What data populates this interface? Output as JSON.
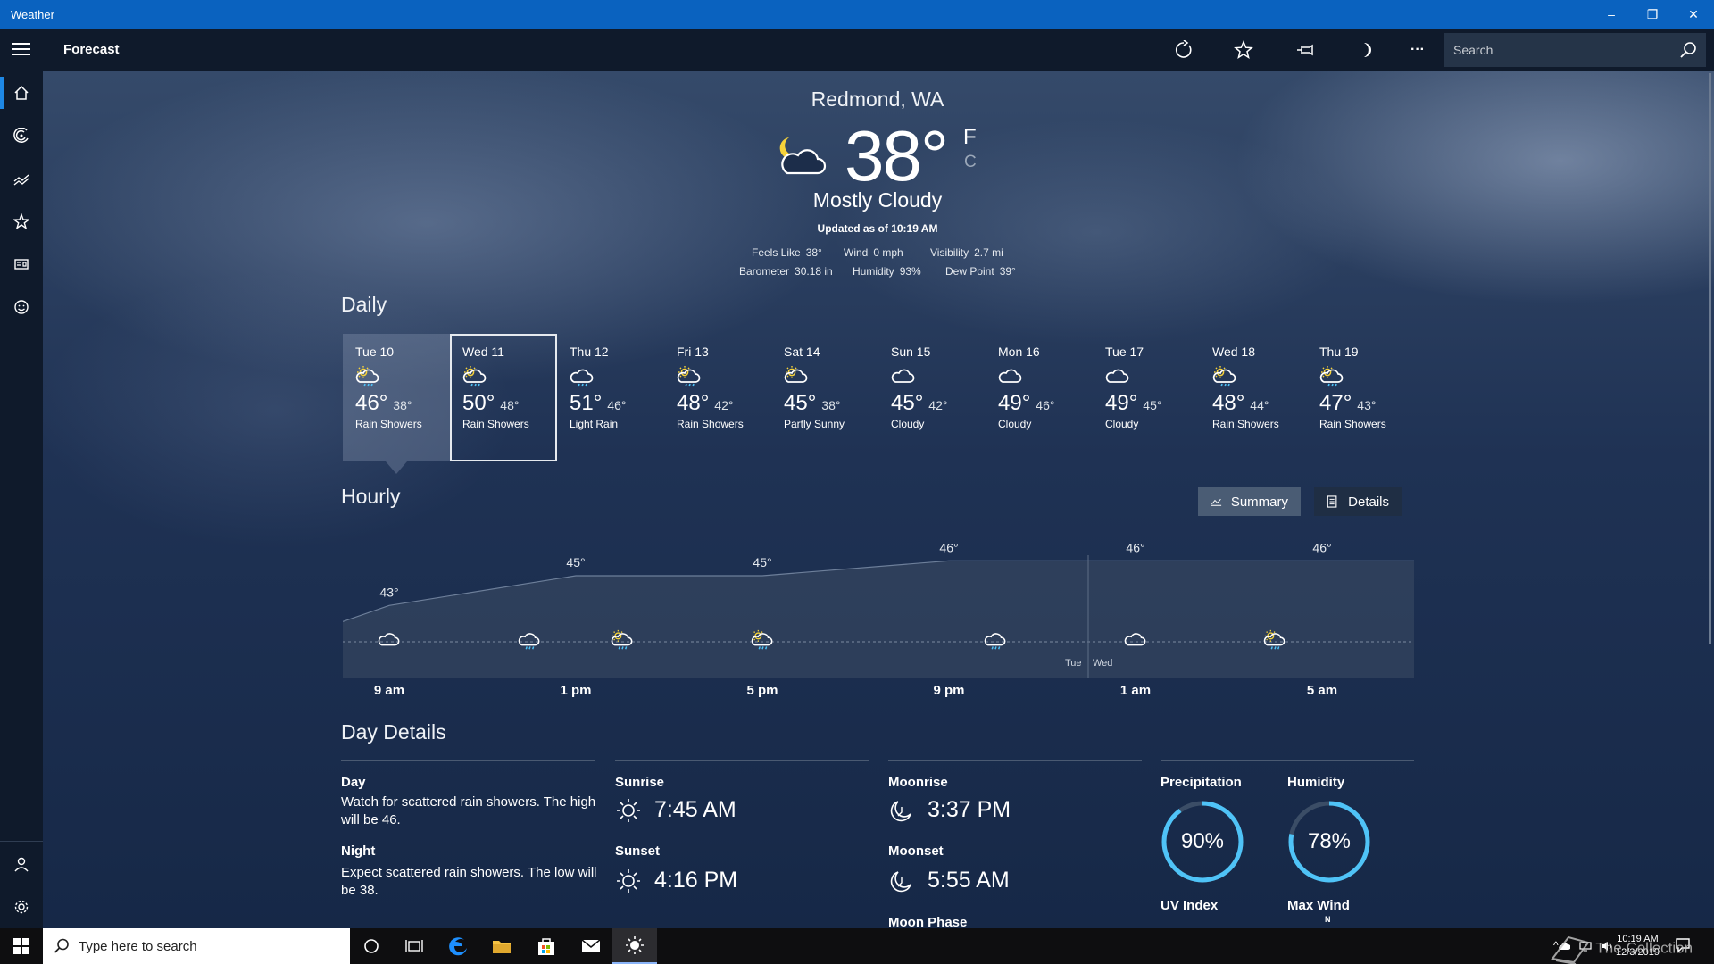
{
  "window": {
    "title": "Weather",
    "minimize": "–",
    "restore": "❐",
    "close": "✕"
  },
  "commandbar": {
    "title": "Forecast",
    "more": "···",
    "search_placeholder": "Search"
  },
  "current": {
    "location": "Redmond, WA",
    "temp": "38°",
    "unit_f": "F",
    "unit_c": "C",
    "condition": "Mostly Cloudy",
    "updated": "Updated as of 10:19 AM",
    "obs": [
      {
        "label": "Feels Like",
        "value": "38°"
      },
      {
        "label": "Wind",
        "value": "0 mph"
      },
      {
        "label": "Visibility",
        "value": "2.7 mi"
      },
      {
        "label": "Barometer",
        "value": "30.18 in"
      },
      {
        "label": "Humidity",
        "value": "93%"
      },
      {
        "label": "Dew Point",
        "value": "39°"
      }
    ]
  },
  "daily": {
    "title": "Daily",
    "days": [
      {
        "day": "Tue 10",
        "hi": "46°",
        "lo": "38°",
        "cond": "Rain Showers",
        "icon": "partly-sunny-rain-icon"
      },
      {
        "day": "Wed 11",
        "hi": "50°",
        "lo": "48°",
        "cond": "Rain Showers",
        "icon": "partly-sunny-rain-icon"
      },
      {
        "day": "Thu 12",
        "hi": "51°",
        "lo": "46°",
        "cond": "Light Rain",
        "icon": "rain-icon"
      },
      {
        "day": "Fri 13",
        "hi": "48°",
        "lo": "42°",
        "cond": "Rain Showers",
        "icon": "partly-sunny-rain-icon"
      },
      {
        "day": "Sat 14",
        "hi": "45°",
        "lo": "38°",
        "cond": "Partly Sunny",
        "icon": "partly-sunny-icon"
      },
      {
        "day": "Sun 15",
        "hi": "45°",
        "lo": "42°",
        "cond": "Cloudy",
        "icon": "cloud-icon"
      },
      {
        "day": "Mon 16",
        "hi": "49°",
        "lo": "46°",
        "cond": "Cloudy",
        "icon": "cloud-icon"
      },
      {
        "day": "Tue 17",
        "hi": "49°",
        "lo": "45°",
        "cond": "Cloudy",
        "icon": "cloud-icon"
      },
      {
        "day": "Wed 18",
        "hi": "48°",
        "lo": "44°",
        "cond": "Rain Showers",
        "icon": "partly-sunny-rain-icon"
      },
      {
        "day": "Thu 19",
        "hi": "47°",
        "lo": "43°",
        "cond": "Rain Showers",
        "icon": "partly-sunny-rain-icon"
      }
    ]
  },
  "hourly": {
    "title": "Hourly",
    "summary_label": "Summary",
    "details_label": "Details",
    "temp_labels": [
      "43°",
      "45°",
      "45°",
      "46°",
      "46°",
      "46°"
    ],
    "time_labels": [
      "9 am",
      "1 pm",
      "5 pm",
      "9 pm",
      "1 am",
      "5 am"
    ],
    "day_split": [
      "Tue",
      "Wed"
    ]
  },
  "chart_data": {
    "type": "area",
    "x": [
      "9 am",
      "1 pm",
      "5 pm",
      "9 pm",
      "1 am",
      "5 am"
    ],
    "y": [
      43,
      45,
      45,
      46,
      46,
      46
    ],
    "ylabel": "",
    "xlabel": ""
  },
  "details": {
    "title": "Day Details",
    "day_label": "Day",
    "day_text": "Watch for scattered rain showers. The high will be 46.",
    "night_label": "Night",
    "night_text": "Expect scattered rain showers. The low will be 38.",
    "sunrise_label": "Sunrise",
    "sunrise": "7:45 AM",
    "sunset_label": "Sunset",
    "sunset": "4:16 PM",
    "moonrise_label": "Moonrise",
    "moonrise": "3:37 PM",
    "moonset_label": "Moonset",
    "moonset": "5:55 AM",
    "moonphase_label": "Moon Phase",
    "precip_label": "Precipitation",
    "precip": "90%",
    "precip_fraction": 0.9,
    "humidity_label": "Humidity",
    "humidity": "78%",
    "humidity_fraction": 0.78,
    "uv_label": "UV Index",
    "wind_label": "Max Wind",
    "wind_dir": "N",
    "ring_color": "#4fc3f7"
  },
  "taskbar": {
    "search_placeholder": "Type here to search",
    "time": "10:19 AM",
    "date": "12/3/2019",
    "watermark": "The Collection Book"
  }
}
